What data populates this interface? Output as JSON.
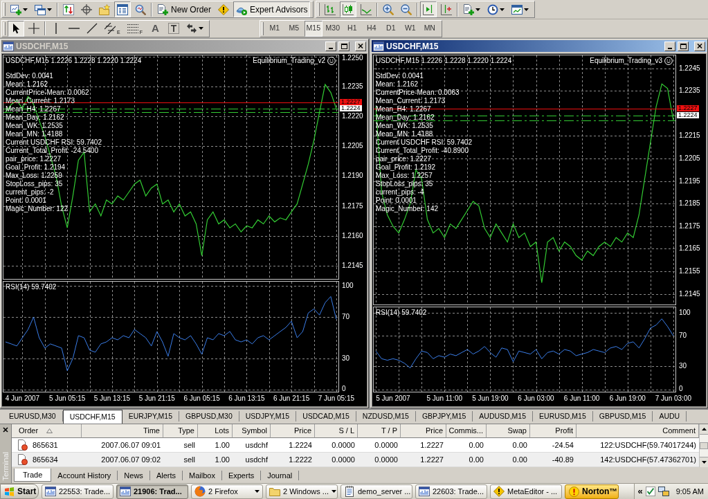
{
  "toolbar_rows": [
    [
      {
        "groups": [
          [
            {
              "kind": "new-chart",
              "pressed": false,
              "menu": true
            },
            {
              "kind": "profiles",
              "pressed": false,
              "menu": true
            }
          ],
          [
            {
              "kind": "market-watch",
              "pressed": false,
              "menu": false
            },
            {
              "kind": "navigator",
              "pressed": false,
              "menu": false
            },
            {
              "kind": "favorites",
              "pressed": false,
              "menu": false
            },
            {
              "kind": "data-window",
              "pressed": true,
              "menu": false
            },
            {
              "kind": "tester",
              "pressed": false,
              "menu": false
            }
          ],
          [
            {
              "kind": "new-order",
              "label": "New Order",
              "pressed": false,
              "menu": false
            },
            {
              "kind": "alert",
              "pressed": false,
              "menu": false
            },
            {
              "kind": "expert-advisors",
              "label": "Expert Advisors",
              "pressed": true,
              "menu": false
            }
          ]
        ]
      },
      {
        "groups": [
          [
            {
              "kind": "bar-chart",
              "pressed": false,
              "menu": false
            },
            {
              "kind": "candlesticks",
              "pressed": true,
              "menu": false
            },
            {
              "kind": "line-chart",
              "pressed": false,
              "menu": false
            }
          ],
          [
            {
              "kind": "zoom-in",
              "pressed": false,
              "menu": false
            },
            {
              "kind": "zoom-out",
              "pressed": false,
              "menu": false
            }
          ],
          [
            {
              "kind": "chart-shift",
              "pressed": true,
              "menu": false
            },
            {
              "kind": "auto-scroll",
              "pressed": false,
              "menu": false
            }
          ],
          [
            {
              "kind": "indicators",
              "pressed": false,
              "menu": true
            },
            {
              "kind": "periods",
              "pressed": false,
              "menu": true
            },
            {
              "kind": "templates",
              "pressed": false,
              "menu": true
            }
          ]
        ]
      }
    ],
    [
      {
        "groups": [
          [
            {
              "kind": "cursor",
              "pressed": true,
              "menu": false
            },
            {
              "kind": "crosshair",
              "pressed": false,
              "menu": false
            }
          ],
          [
            {
              "kind": "vertical-line",
              "pressed": false,
              "menu": false
            },
            {
              "kind": "horizontal-line",
              "pressed": false,
              "menu": false
            },
            {
              "kind": "trendline",
              "pressed": false,
              "menu": false
            },
            {
              "kind": "channel",
              "label": "E",
              "pressed": false,
              "menu": false
            },
            {
              "kind": "fibonacci",
              "label": "F",
              "pressed": false,
              "menu": false
            },
            {
              "kind": "text",
              "label": "A",
              "pressed": false,
              "menu": false
            },
            {
              "kind": "text-label",
              "pressed": false,
              "menu": false
            },
            {
              "kind": "arrows",
              "pressed": false,
              "menu": true
            }
          ]
        ]
      },
      {
        "groups": [
          [
            {
              "kind": "period",
              "label": "M1",
              "pressed": false
            },
            {
              "kind": "period",
              "label": "M5",
              "pressed": false
            },
            {
              "kind": "period",
              "label": "M15",
              "pressed": true
            },
            {
              "kind": "period",
              "label": "M30",
              "pressed": false
            },
            {
              "kind": "period",
              "label": "H1",
              "pressed": false
            },
            {
              "kind": "period",
              "label": "H4",
              "pressed": false
            },
            {
              "kind": "period",
              "label": "D1",
              "pressed": false
            },
            {
              "kind": "period",
              "label": "W1",
              "pressed": false
            },
            {
              "kind": "period",
              "label": "MN",
              "pressed": false
            }
          ]
        ]
      }
    ]
  ],
  "windows": [
    {
      "title": "USDCHF,M15",
      "active": false,
      "expert": "Equilibrium_Trading_v2",
      "readouts": [
        "StdDev: 0.0041",
        "Mean: 1.2162",
        "CurrentPrice-Mean: 0.0062",
        "Mean_Current: 1.2173",
        "Mean_H4: 1.2267",
        "Mean_Day: 1.2162",
        "Mean_WK: 1.2535",
        "Mean_MN: 1.4188",
        "Current USDCHF RSI: 59.7402",
        "Current_Total_Profit: -24.5400",
        "pair_price: 1.2227",
        "Goal_Profit: 1.2194",
        "Max_Loss: 1.2259",
        "StopLoss_pips: 35",
        "current_pips: -2",
        "Point: 0.0001",
        "Magic_Number: 122"
      ],
      "price_chart": {
        "chart_data": {
          "type": "line",
          "title": "USDCHF,M15 1.2226 1.2228 1.2220 1.2224",
          "ylim": [
            1.2138,
            1.2251
          ],
          "yticks": [
            {
              "value": 1.225,
              "label": "1.2250"
            },
            {
              "value": 1.2235,
              "label": "1.2235"
            },
            {
              "value": 1.222,
              "label": "1.2220"
            },
            {
              "value": 1.2205,
              "label": "1.2205"
            },
            {
              "value": 1.219,
              "label": "1.2190"
            },
            {
              "value": 1.2175,
              "label": "1.2175"
            },
            {
              "value": 1.216,
              "label": "1.2160"
            },
            {
              "value": 1.2145,
              "label": "1.2145"
            }
          ],
          "grid": true,
          "series": [
            {
              "color": "#33cc33",
              "values": [
                1.2222,
                1.2226,
                1.2228,
                1.2224,
                1.223,
                1.2226,
                1.2218,
                1.221,
                1.22,
                1.219,
                1.2175,
                1.2164,
                1.218,
                1.2198,
                1.2202,
                1.2172,
                1.2176,
                1.217,
                1.2178,
                1.2176,
                1.218,
                1.2178,
                1.2182,
                1.2186,
                1.2188,
                1.218,
                1.2184,
                1.2186,
                1.2176,
                1.2178,
                1.2172,
                1.2176,
                1.217,
                1.2172,
                1.2166,
                1.215,
                1.2168,
                1.2172,
                1.2166,
                1.2168,
                1.2164,
                1.2166,
                1.2162,
                1.2165,
                1.2164,
                1.2168,
                1.2166,
                1.217,
                1.2167,
                1.2169,
                1.2168,
                1.2172,
                1.2176,
                1.2186,
                1.2196,
                1.2208,
                1.2222,
                1.2236,
                1.2232,
                1.2224
              ]
            }
          ],
          "ref_lines": [
            {
              "axis": "y",
              "value": 1.2227,
              "color": "#ee1010",
              "label": "1.2227"
            },
            {
              "axis": "y",
              "value": 1.2224,
              "color": "#33cc33",
              "line_style": "dashed",
              "label": "1.2224"
            },
            {
              "axis": "y",
              "value": 1.2222,
              "color": "#33cc33",
              "line_style": "dashed"
            }
          ]
        }
      },
      "rsi_chart": {
        "chart_data": {
          "type": "line",
          "title": "RSI(14) 59.7402",
          "categories": [
            null,
            null,
            null,
            "4 Jun 2007",
            null,
            null,
            null,
            null,
            null,
            null,
            null,
            "5 Jun 05:15",
            null,
            null,
            null,
            null,
            null,
            null,
            null,
            "5 Jun 13:15",
            null,
            null,
            null,
            null,
            null,
            null,
            null,
            "5 Jun 21:15",
            null,
            null,
            null,
            null,
            null,
            null,
            null,
            "6 Jun 05:15",
            null,
            null,
            null,
            null,
            null,
            null,
            null,
            "6 Jun 13:15",
            null,
            null,
            null,
            null,
            null,
            null,
            null,
            "6 Jun 21:15",
            null,
            null,
            null,
            null,
            null,
            null,
            null,
            "7 Jun 05:15"
          ],
          "ylim": [
            -3,
            105
          ],
          "yticks": [
            100,
            70,
            30,
            0
          ],
          "grid": true,
          "series": [
            {
              "color": "#3a7de8",
              "values": [
                46,
                44,
                42,
                50,
                58,
                70,
                50,
                40,
                44,
                42,
                40,
                18,
                30,
                52,
                50,
                38,
                36,
                44,
                46,
                50,
                48,
                52,
                50,
                58,
                54,
                50,
                42,
                56,
                46,
                32,
                54,
                50,
                48,
                52,
                44,
                34,
                50,
                48,
                54,
                52,
                56,
                48,
                46,
                48,
                44,
                50,
                52,
                48,
                52,
                56,
                60,
                66,
                50,
                56,
                74,
                78,
                72,
                84,
                90,
                68
              ]
            }
          ]
        }
      }
    },
    {
      "title": "USDCHF,M15",
      "active": true,
      "expert": "Equilibrium_Trading_v3",
      "readouts": [
        "StdDev: 0.0041",
        "Mean: 1.2162",
        "CurrentPrice-Mean: 0.0063",
        "Mean_Current: 1.2173",
        "Mean_H4: 1.2267",
        "Mean_Day: 1.2162",
        "Mean_WK: 1.2535",
        "Mean_MN: 1.4188",
        "Current USDCHF RSI: 59.7402",
        "Current_Total_Profit: -40.8900",
        "pair_price: 1.2227",
        "Goal_Profit: 1.2192",
        "Max_Loss: 1.2257",
        "StopLoss_pips: 35",
        "current_pips: -4",
        "Point: 0.0001",
        "Magic_Number: 142"
      ],
      "price_chart": {
        "chart_data": {
          "type": "line",
          "title": "USDCHF,M15 1.2226 1.2228 1.2220 1.2224",
          "ylim": [
            1.214,
            1.2251
          ],
          "yticks": [
            {
              "value": 1.2245,
              "label": "1.2245"
            },
            {
              "value": 1.2235,
              "label": "1.2235"
            },
            {
              "value": 1.2215,
              "label": "1.2215"
            },
            {
              "value": 1.2205,
              "label": "1.2205"
            },
            {
              "value": 1.2195,
              "label": "1.2195"
            },
            {
              "value": 1.2185,
              "label": "1.2185"
            },
            {
              "value": 1.2175,
              "label": "1.2175"
            },
            {
              "value": 1.2165,
              "label": "1.2165"
            },
            {
              "value": 1.2155,
              "label": "1.2155"
            },
            {
              "value": 1.2145,
              "label": "1.2145"
            }
          ],
          "grid": true,
          "series": [
            {
              "color": "#33cc33",
              "values": [
                1.2228,
                1.219,
                1.218,
                1.2175,
                1.2172,
                1.2178,
                1.2185,
                1.22,
                1.2196,
                1.2178,
                1.2172,
                1.2174,
                1.217,
                1.2176,
                1.2174,
                1.2178,
                1.2182,
                1.2186,
                1.2184,
                1.2174,
                1.217,
                1.2176,
                1.2172,
                1.2168,
                1.2176,
                1.217,
                1.2172,
                1.2166,
                1.2168,
                1.215,
                1.2168,
                1.217,
                1.2164,
                1.2168,
                1.2166,
                1.2162,
                1.216,
                1.2164,
                1.2162,
                1.2166,
                1.2168,
                1.2166,
                1.217,
                1.2168,
                1.2172,
                1.217,
                1.218,
                1.2196,
                1.2212,
                1.2228,
                1.2238,
                1.2236,
                1.2222
              ]
            }
          ],
          "ref_lines": [
            {
              "axis": "y",
              "value": 1.2227,
              "color": "#ee1010",
              "label": "1.2227"
            },
            {
              "axis": "y",
              "value": 1.2224,
              "color": "#33cc33",
              "line_style": "dashed",
              "label": "1.2224"
            },
            {
              "axis": "y",
              "value": 1.2222,
              "color": "#33cc33",
              "line_style": "dashed"
            }
          ]
        }
      },
      "rsi_chart": {
        "chart_data": {
          "type": "line",
          "title": "RSI(14) 59.7402",
          "categories": [
            null,
            null,
            null,
            "5 Jun 2007",
            null,
            null,
            null,
            null,
            null,
            null,
            null,
            null,
            "5 Jun 11:00",
            null,
            null,
            null,
            null,
            null,
            null,
            null,
            "5 Jun 19:00",
            null,
            null,
            null,
            null,
            null,
            null,
            null,
            "6 Jun 03:00",
            null,
            null,
            null,
            null,
            null,
            null,
            null,
            "6 Jun 11:00",
            null,
            null,
            null,
            null,
            null,
            null,
            null,
            "6 Jun 19:00",
            null,
            null,
            null,
            null,
            null,
            null,
            null,
            "7 Jun 03:00"
          ],
          "ylim": [
            -4,
            108
          ],
          "yticks": [
            100,
            70,
            30,
            0
          ],
          "grid": true,
          "series": [
            {
              "color": "#3a7de8",
              "values": [
                50,
                40,
                38,
                40,
                38,
                34,
                28,
                40,
                50,
                48,
                40,
                44,
                42,
                46,
                44,
                48,
                52,
                46,
                50,
                56,
                48,
                42,
                54,
                52,
                36,
                50,
                48,
                46,
                52,
                40,
                48,
                50,
                46,
                52,
                50,
                44,
                46,
                48,
                52,
                50,
                48,
                54,
                56,
                52,
                60,
                62,
                54,
                66,
                80,
                84,
                92,
                82,
                70
              ]
            }
          ]
        }
      }
    }
  ],
  "chart_tabs": [
    {
      "label": "EURUSD,M30",
      "selected": false
    },
    {
      "label": "USDCHF,M15",
      "selected": true
    },
    {
      "label": "EURJPY,M15",
      "selected": false
    },
    {
      "label": "GBPUSD,M30",
      "selected": false
    },
    {
      "label": "USDJPY,M15",
      "selected": false
    },
    {
      "label": "USDCAD,M15",
      "selected": false
    },
    {
      "label": "NZDUSD,M15",
      "selected": false
    },
    {
      "label": "GBPJPY,M15",
      "selected": false
    },
    {
      "label": "AUDUSD,M15",
      "selected": false
    },
    {
      "label": "EURUSD,M15",
      "selected": false
    },
    {
      "label": "GBPUSD,M15",
      "selected": false
    },
    {
      "label": "AUDU",
      "selected": false
    }
  ],
  "terminal": {
    "title": "Terminal",
    "columns": [
      {
        "label": "Order",
        "sorted": true
      },
      {
        "label": "Time",
        "sorted": false
      },
      {
        "label": "Type",
        "sorted": false
      },
      {
        "label": "Lots",
        "sorted": false
      },
      {
        "label": "Symbol",
        "sorted": false
      },
      {
        "label": "Price",
        "sorted": false
      },
      {
        "label": "S / L",
        "sorted": false
      },
      {
        "label": "T / P",
        "sorted": false
      },
      {
        "label": "Price",
        "sorted": false
      },
      {
        "label": "Commis...",
        "sorted": false
      },
      {
        "label": "Swap",
        "sorted": false
      },
      {
        "label": "Profit",
        "sorted": false
      },
      {
        "label": "Comment",
        "sorted": false
      }
    ],
    "rows": [
      [
        "865631",
        "2007.06.07 09:01",
        "sell",
        "1.00",
        "usdchf",
        "1.2224",
        "0.0000",
        "0.0000",
        "1.2227",
        "0.00",
        "0.00",
        "-24.54",
        "122:USDCHF(59.74017244)"
      ],
      [
        "865634",
        "2007.06.07 09:02",
        "sell",
        "1.00",
        "usdchf",
        "1.2222",
        "0.0000",
        "0.0000",
        "1.2227",
        "0.00",
        "0.00",
        "-40.89",
        "142:USDCHF(57.47362701)"
      ]
    ],
    "tabs": [
      {
        "label": "Trade",
        "selected": true
      },
      {
        "label": "Account History",
        "selected": false
      },
      {
        "label": "News",
        "selected": false
      },
      {
        "label": "Alerts",
        "selected": false
      },
      {
        "label": "Mailbox",
        "selected": false
      },
      {
        "label": "Experts",
        "selected": false
      },
      {
        "label": "Journal",
        "selected": false
      }
    ]
  },
  "taskbar": {
    "start": "Start",
    "tasks": [
      {
        "label": "22553: Trade...",
        "kind": "terminal",
        "selected": false,
        "menu": false
      },
      {
        "label": "21906: Trad...",
        "kind": "terminal",
        "selected": true,
        "menu": false
      },
      {
        "label": "2 Firefox",
        "kind": "browser",
        "selected": false,
        "menu": true
      },
      {
        "label": "2 Windows ...",
        "kind": "folder",
        "selected": false,
        "menu": true
      },
      {
        "label": "demo_server ...",
        "kind": "document",
        "selected": false,
        "menu": false
      },
      {
        "label": "22603: Trade...",
        "kind": "terminal",
        "selected": false,
        "menu": false
      },
      {
        "label": "MetaEditor - ...",
        "kind": "editor",
        "selected": false,
        "menu": false
      }
    ],
    "notifier": "Norton™",
    "tray": {
      "chevron": "«",
      "clock": "9:05 AM"
    }
  }
}
